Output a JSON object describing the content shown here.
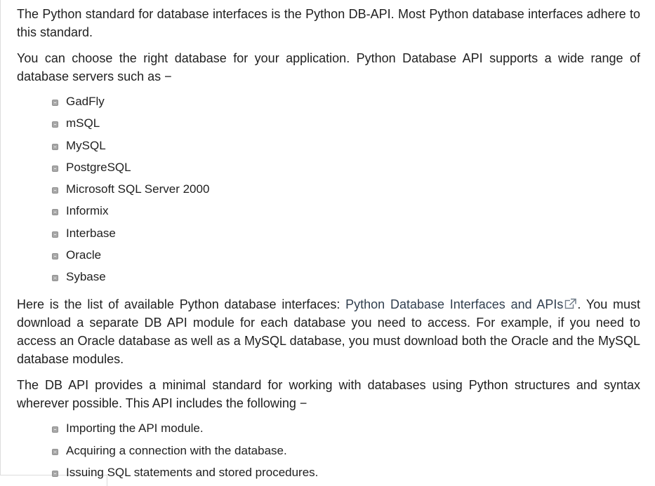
{
  "paragraphs": {
    "p1": "The Python standard for database interfaces is the Python DB-API. Most Python database interfaces adhere to this standard.",
    "p2": "You can choose the right database for your application. Python Database API supports a wide range of database servers such as −",
    "p3_before": "Here is the list of available Python database interfaces: ",
    "p3_link": "Python Database Interfaces and APIs",
    "p3_after": ". You must download a separate DB API module for each database you need to access. For example, if you need to access an Oracle database as well as a MySQL database, you must download both the Oracle and the MySQL database modules.",
    "p4": "The DB API provides a minimal standard for working with databases using Python structures and syntax wherever possible. This API includes the following −"
  },
  "database_servers": [
    "GadFly",
    "mSQL",
    "MySQL",
    "PostgreSQL",
    "Microsoft SQL Server 2000",
    "Informix",
    "Interbase",
    "Oracle",
    "Sybase"
  ],
  "api_includes": [
    "Importing the API module.",
    "Acquiring a connection with the database.",
    "Issuing SQL statements and stored procedures."
  ],
  "icons": {
    "external_link": "external-link-icon",
    "bullet": "square-bullet-icon"
  },
  "colors": {
    "text": "#1f1f1f",
    "link": "#313f4f",
    "bullet": "#a9a9a9"
  }
}
